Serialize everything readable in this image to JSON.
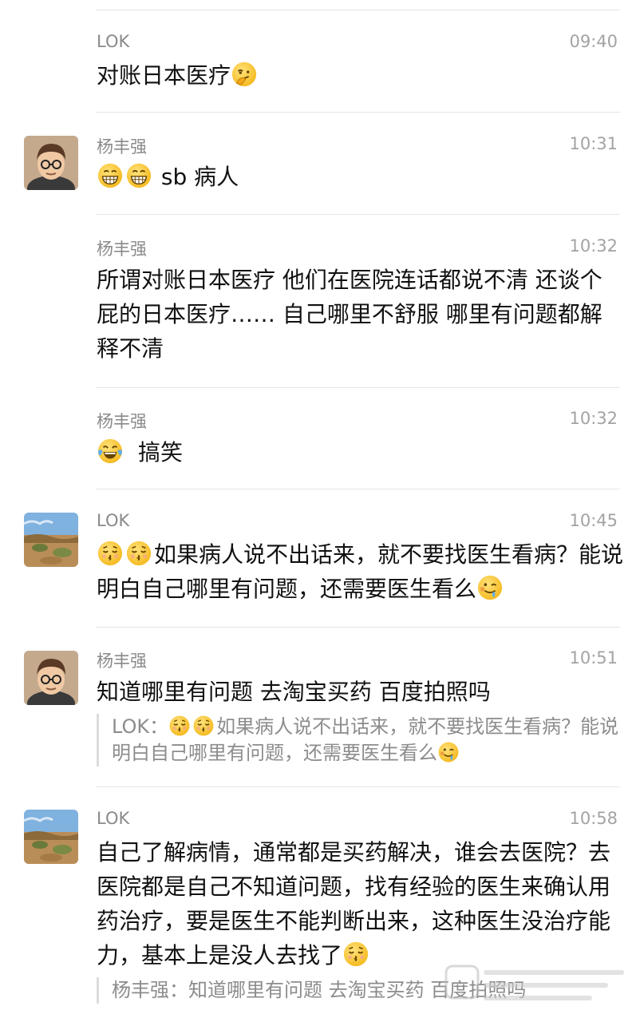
{
  "messages": [
    {
      "sender": "LOK",
      "time": "09:40",
      "text": "对账日本医疗"
    },
    {
      "sender": "杨丰强",
      "time": "10:31",
      "text": "sb 病人"
    },
    {
      "sender": "杨丰强",
      "time": "10:32",
      "text": "所谓对账日本医疗  他们在医院连话都说不清  还谈个屁的日本医疗……  自己哪里不舒服 哪里有问题都解释不清"
    },
    {
      "sender": "杨丰强",
      "time": "10:32",
      "text": "搞笑"
    },
    {
      "sender": "LOK",
      "time": "10:45",
      "text": "如果病人说不出话来，就不要找医生看病？能说明白自己哪里有问题，还需要医生看么"
    },
    {
      "sender": "杨丰强",
      "time": "10:51",
      "text": "知道哪里有问题  去淘宝买药 百度拍照吗",
      "quote_prefix": "LOK：",
      "quote_text": "如果病人说不出话来，就不要找医生看病？能说明白自己哪里有问题，还需要医生看么"
    },
    {
      "sender": "LOK",
      "time": "10:58",
      "text": "自己了解病情，通常都是买药解决，谁会去医院？去医院都是自己不知道问题，找有经验的医生来确认用药治疗，要是医生不能判断出来，这种医生没治疗能力，基本上是没人去找了",
      "quote_prefix": "杨丰强：",
      "quote_text": "知道哪里有问题  去淘宝买药 百度拍照吗"
    }
  ],
  "icons": {
    "thinking": "thinking-face-emoji",
    "grin": "grinning-face-emoji",
    "laugh": "tears-of-joy-emoji",
    "kiss": "kissing-closed-eyes-emoji",
    "drool": "drooling-face-emoji"
  }
}
